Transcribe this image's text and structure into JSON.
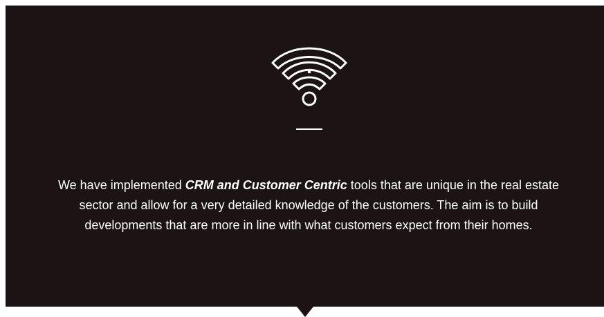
{
  "panel": {
    "icon": "wifi-icon",
    "text_before": "We have implemented ",
    "text_emphasis": "CRM and Customer Centric",
    "text_after": " tools that are unique in the real estate sector and allow for a very detailed knowledge of the customers. The aim is to build developments that are more in line with what customers expect from their homes."
  },
  "colors": {
    "background": "#1b1314",
    "text": "#ffffff"
  }
}
